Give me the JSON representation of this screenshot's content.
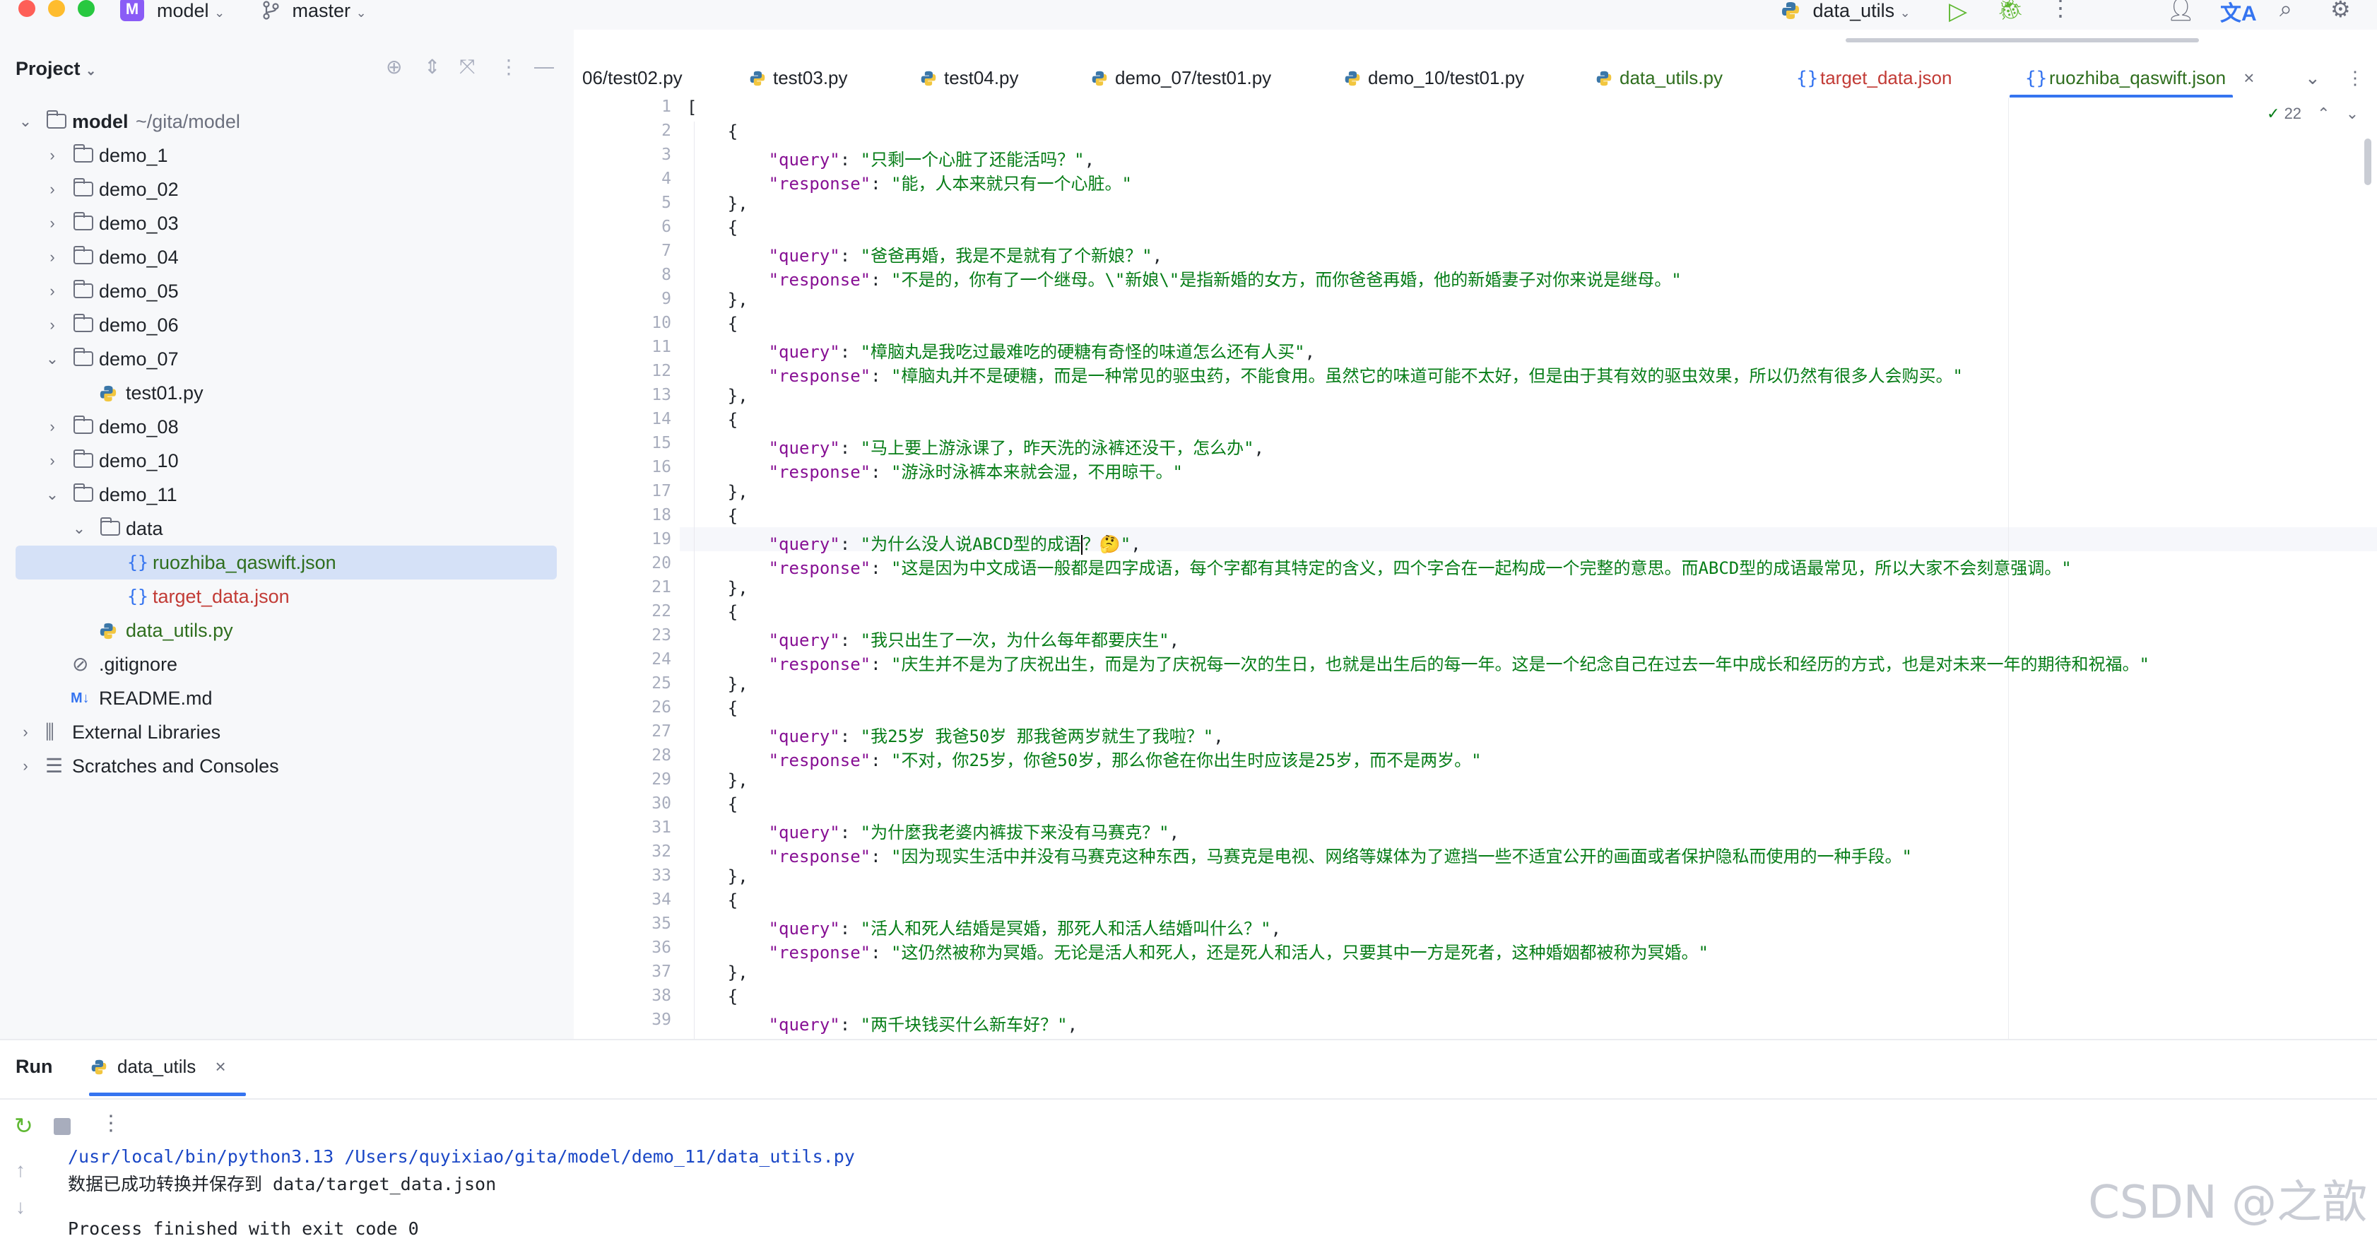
{
  "titlebar": {
    "project_badge": "M",
    "project_name": "model",
    "branch_name": "master",
    "run_config": "data_utils"
  },
  "project_panel": {
    "title": "Project",
    "root_name": "model",
    "root_path": "~/gita/model",
    "items": [
      {
        "label": "demo_1"
      },
      {
        "label": "demo_02"
      },
      {
        "label": "demo_03"
      },
      {
        "label": "demo_04"
      },
      {
        "label": "demo_05"
      },
      {
        "label": "demo_06"
      },
      {
        "label": "demo_07"
      },
      {
        "label": "test01.py"
      },
      {
        "label": "demo_08"
      },
      {
        "label": "demo_10"
      },
      {
        "label": "demo_11"
      },
      {
        "label": "data"
      },
      {
        "label": "ruozhiba_qaswift.json"
      },
      {
        "label": "target_data.json"
      },
      {
        "label": "data_utils.py"
      },
      {
        "label": ".gitignore"
      },
      {
        "label": "README.md"
      },
      {
        "label": "External Libraries"
      },
      {
        "label": "Scratches and Consoles"
      }
    ]
  },
  "tabs": [
    {
      "label": "06/test02.py"
    },
    {
      "label": "test03.py"
    },
    {
      "label": "test04.py"
    },
    {
      "label": "demo_07/test01.py"
    },
    {
      "label": "demo_10/test01.py"
    },
    {
      "label": "data_utils.py"
    },
    {
      "label": "target_data.json"
    },
    {
      "label": "ruozhiba_qaswift.json"
    }
  ],
  "editor": {
    "inspection_count": "22",
    "line_numbers": [
      "1",
      "2",
      "3",
      "4",
      "5",
      "6",
      "7",
      "8",
      "9",
      "10",
      "11",
      "12",
      "13",
      "14",
      "15",
      "16",
      "17",
      "18",
      "19",
      "20",
      "21",
      "22",
      "23",
      "24",
      "25",
      "26",
      "27",
      "28",
      "29",
      "30",
      "31",
      "32",
      "33",
      "34",
      "35",
      "36",
      "37",
      "38",
      "39"
    ],
    "query_key": "\"query\"",
    "response_key": "\"response\"",
    "entries": [
      {
        "q": "\"只剩一个心脏了还能活吗？\"",
        "r": "\"能，人本来就只有一个心脏。\""
      },
      {
        "q": "\"爸爸再婚，我是不是就有了个新娘？\"",
        "r": "\"不是的，你有了一个继母。\\\"新娘\\\"是指新婚的女方，而你爸爸再婚，他的新婚妻子对你来说是继母。\""
      },
      {
        "q": "\"樟脑丸是我吃过最难吃的硬糖有奇怪的味道怎么还有人买\"",
        "r": "\"樟脑丸并不是硬糖，而是一种常见的驱虫药，不能食用。虽然它的味道可能不太好，但是由于其有效的驱虫效果，所以仍然有很多人会购买。\""
      },
      {
        "q": "\"马上要上游泳课了，昨天洗的泳裤还没干，怎么办\"",
        "r": "\"游泳时泳裤本来就会湿，不用晾干。\""
      },
      {
        "q_before_caret": "\"为什么没人说ABCD型的成语",
        "q_after_caret": "？🤔\"",
        "r": "\"这是因为中文成语一般都是四字成语，每个字都有其特定的含义，四个字合在一起构成一个完整的意思。而ABCD型的成语最常见，所以大家不会刻意强调。\""
      },
      {
        "q": "\"我只出生了一次，为什么每年都要庆生\"",
        "r": "\"庆生并不是为了庆祝出生，而是为了庆祝每一次的生日，也就是出生后的每一年。这是一个纪念自己在过去一年中成长和经历的方式，也是对未来一年的期待和祝福。\""
      },
      {
        "q": "\"我25岁 我爸50岁 那我爸两岁就生了我啦？\"",
        "r": "\"不对，你25岁，你爸50岁，那么你爸在你出生时应该是25岁，而不是两岁。\""
      },
      {
        "q": "\"为什麼我老婆内裤拔下来没有马赛克？\"",
        "r": "\"因为现实生活中并没有马赛克这种东西，马赛克是电视、网络等媒体为了遮挡一些不适宜公开的画面或者保护隐私而使用的一种手段。\""
      },
      {
        "q": "\"活人和死人结婚是冥婚，那死人和活人结婚叫什么？\"",
        "r": "\"这仍然被称为冥婚。无论是活人和死人，还是死人和活人，只要其中一方是死者，这种婚姻都被称为冥婚。\""
      },
      {
        "q": "\"两千块钱买什么新车好？\""
      }
    ]
  },
  "run_panel": {
    "title": "Run",
    "tab_label": "data_utils",
    "console": [
      "/usr/local/bin/python3.13 /Users/quyixiao/gita/model/demo_11/data_utils.py",
      "数据已成功转换并保存到 data/target_data.json",
      "",
      "Process finished with exit code 0"
    ]
  },
  "watermark": "CSDN @之歆",
  "colors": {
    "accent": "#3574f0",
    "json_key": "#871094",
    "json_string": "#067d17",
    "run_green": "#5fb832"
  }
}
